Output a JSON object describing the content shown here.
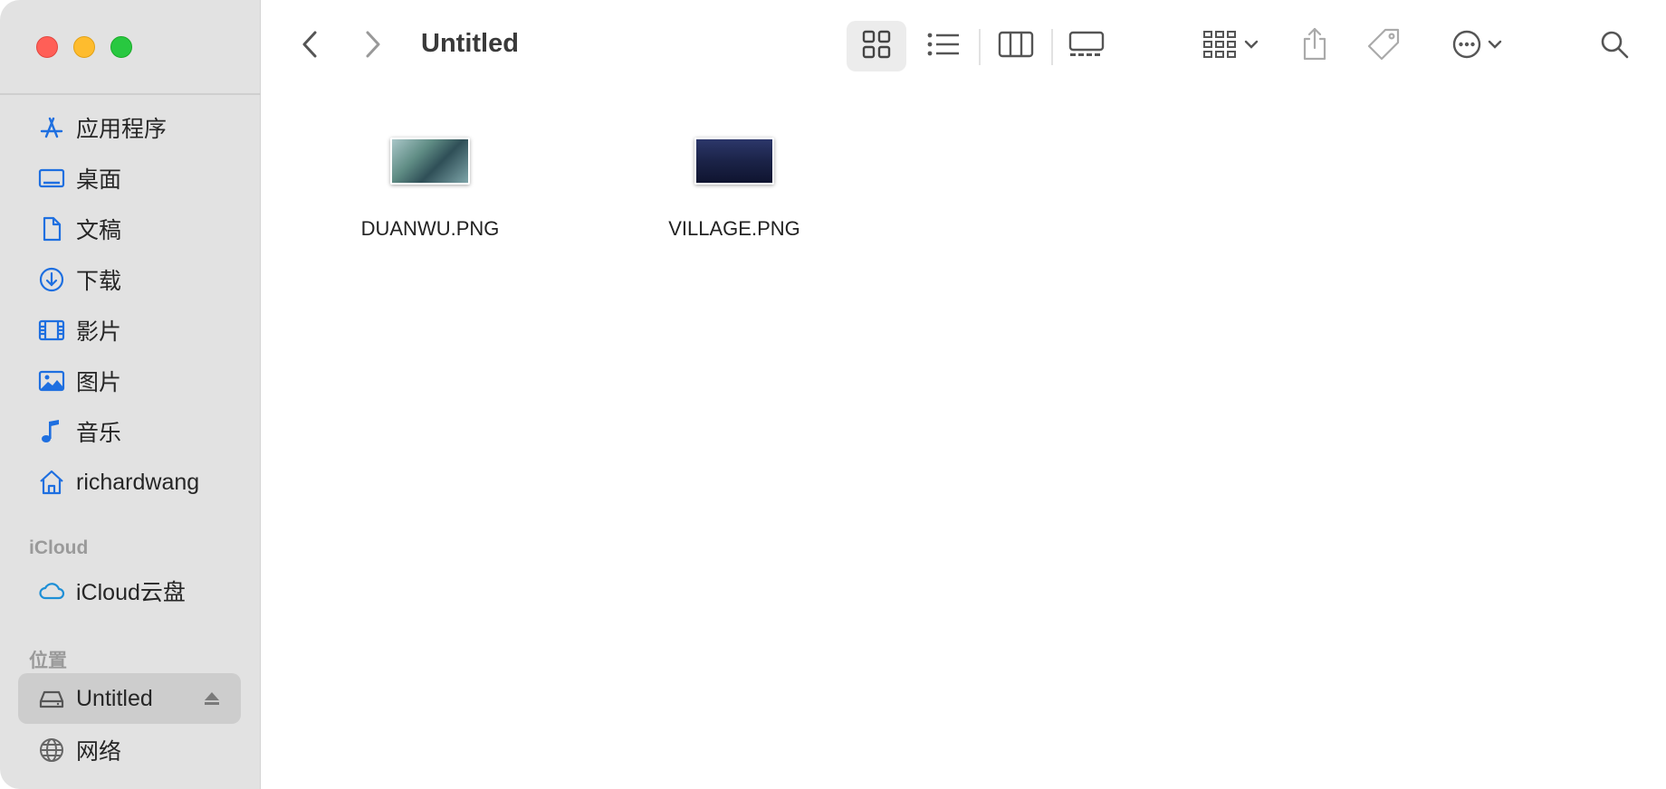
{
  "window": {
    "title": "Untitled"
  },
  "sidebar": {
    "favorites": [
      {
        "label": "应用程序",
        "icon": "applications-icon"
      },
      {
        "label": "桌面",
        "icon": "desktop-icon"
      },
      {
        "label": "文稿",
        "icon": "document-icon"
      },
      {
        "label": "下载",
        "icon": "download-icon"
      },
      {
        "label": "影片",
        "icon": "film-icon"
      },
      {
        "label": "图片",
        "icon": "photo-icon"
      },
      {
        "label": "音乐",
        "icon": "music-icon"
      },
      {
        "label": "richardwang",
        "icon": "home-icon"
      }
    ],
    "icloud_heading": "iCloud",
    "icloud_items": [
      {
        "label": "iCloud云盘",
        "icon": "cloud-icon"
      }
    ],
    "locations_heading": "位置",
    "locations": [
      {
        "label": "Untitled",
        "icon": "drive-icon",
        "selected": true,
        "ejectable": true
      },
      {
        "label": "网络",
        "icon": "globe-icon"
      }
    ]
  },
  "toolbar": {
    "back": "chevron-left-icon",
    "forward": "chevron-right-icon",
    "views": [
      "icon-view-icon",
      "list-view-icon",
      "column-view-icon",
      "gallery-view-icon"
    ],
    "active_view": "icon-view-icon",
    "group": "group-icon",
    "share": "share-icon",
    "tag": "tag-icon",
    "more": "ellipsis-circle-icon",
    "search": "search-icon"
  },
  "files": [
    {
      "name": "DUANWU.PNG",
      "thumb_colors": [
        "#6b8f7a",
        "#3c5b6a"
      ]
    },
    {
      "name": "VILLAGE.PNG",
      "thumb_colors": [
        "#26305a",
        "#141a36"
      ]
    }
  ],
  "colors": {
    "accent": "#1e6fe0",
    "sidebar_bg": "#e2e2e2",
    "selected_bg": "#cdcdcd"
  }
}
